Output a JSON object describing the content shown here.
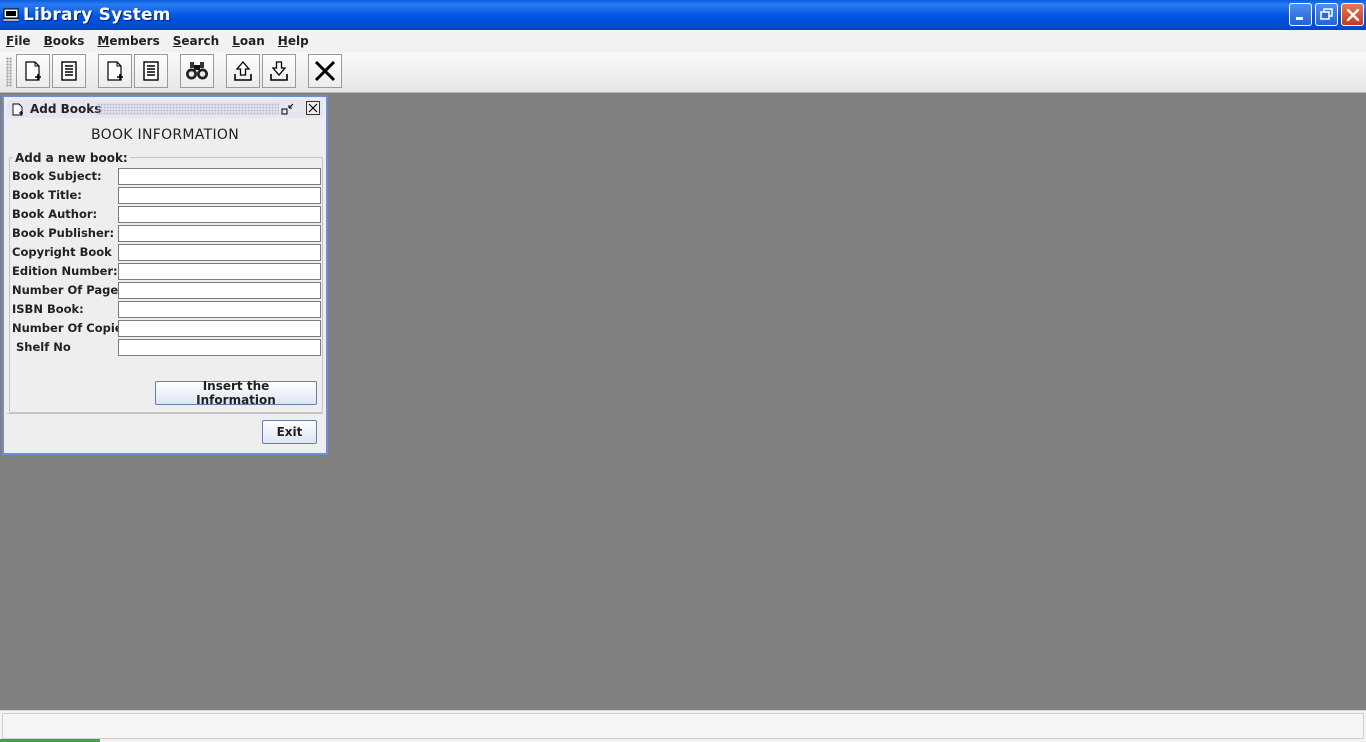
{
  "window": {
    "title": "Library System"
  },
  "menu": {
    "items": [
      {
        "label": "File",
        "mnemonic": "F",
        "rest": "ile"
      },
      {
        "label": "Books",
        "mnemonic": "B",
        "rest": "ooks"
      },
      {
        "label": "Members",
        "mnemonic": "M",
        "rest": "embers"
      },
      {
        "label": "Search",
        "mnemonic": "S",
        "rest": "earch"
      },
      {
        "label": "Loan",
        "mnemonic": "L",
        "rest": "oan"
      },
      {
        "label": "Help",
        "mnemonic": "H",
        "rest": "elp"
      }
    ]
  },
  "toolbar": {
    "buttons": [
      {
        "icon": "new-document-icon"
      },
      {
        "icon": "list-document-icon"
      },
      {
        "icon": "new-document-icon"
      },
      {
        "icon": "list-document-icon"
      },
      {
        "icon": "binoculars-icon"
      },
      {
        "icon": "upload-icon"
      },
      {
        "icon": "download-icon"
      },
      {
        "icon": "exit-x-icon"
      }
    ]
  },
  "add_books": {
    "title": "Add Books",
    "heading": "BOOK INFORMATION",
    "group_label": "Add a new book:",
    "fields": [
      {
        "label": "Book Subject:",
        "value": ""
      },
      {
        "label": "Book Title:",
        "value": ""
      },
      {
        "label": "Book Author:",
        "value": ""
      },
      {
        "label": "Book Publisher:",
        "value": ""
      },
      {
        "label": "Copyright Book",
        "value": ""
      },
      {
        "label": "Edition Number:",
        "value": ""
      },
      {
        "label": "Number Of Pages:",
        "value": ""
      },
      {
        "label": "ISBN Book:",
        "value": ""
      },
      {
        "label": "Number Of Copies:",
        "value": ""
      },
      {
        "label": " Shelf No",
        "value": ""
      }
    ],
    "insert_label": "Insert the Information",
    "exit_label": "Exit"
  },
  "colors": {
    "titlebar": "#0054e3",
    "desktop": "#808080",
    "frame_border": "#6b8fd6"
  }
}
